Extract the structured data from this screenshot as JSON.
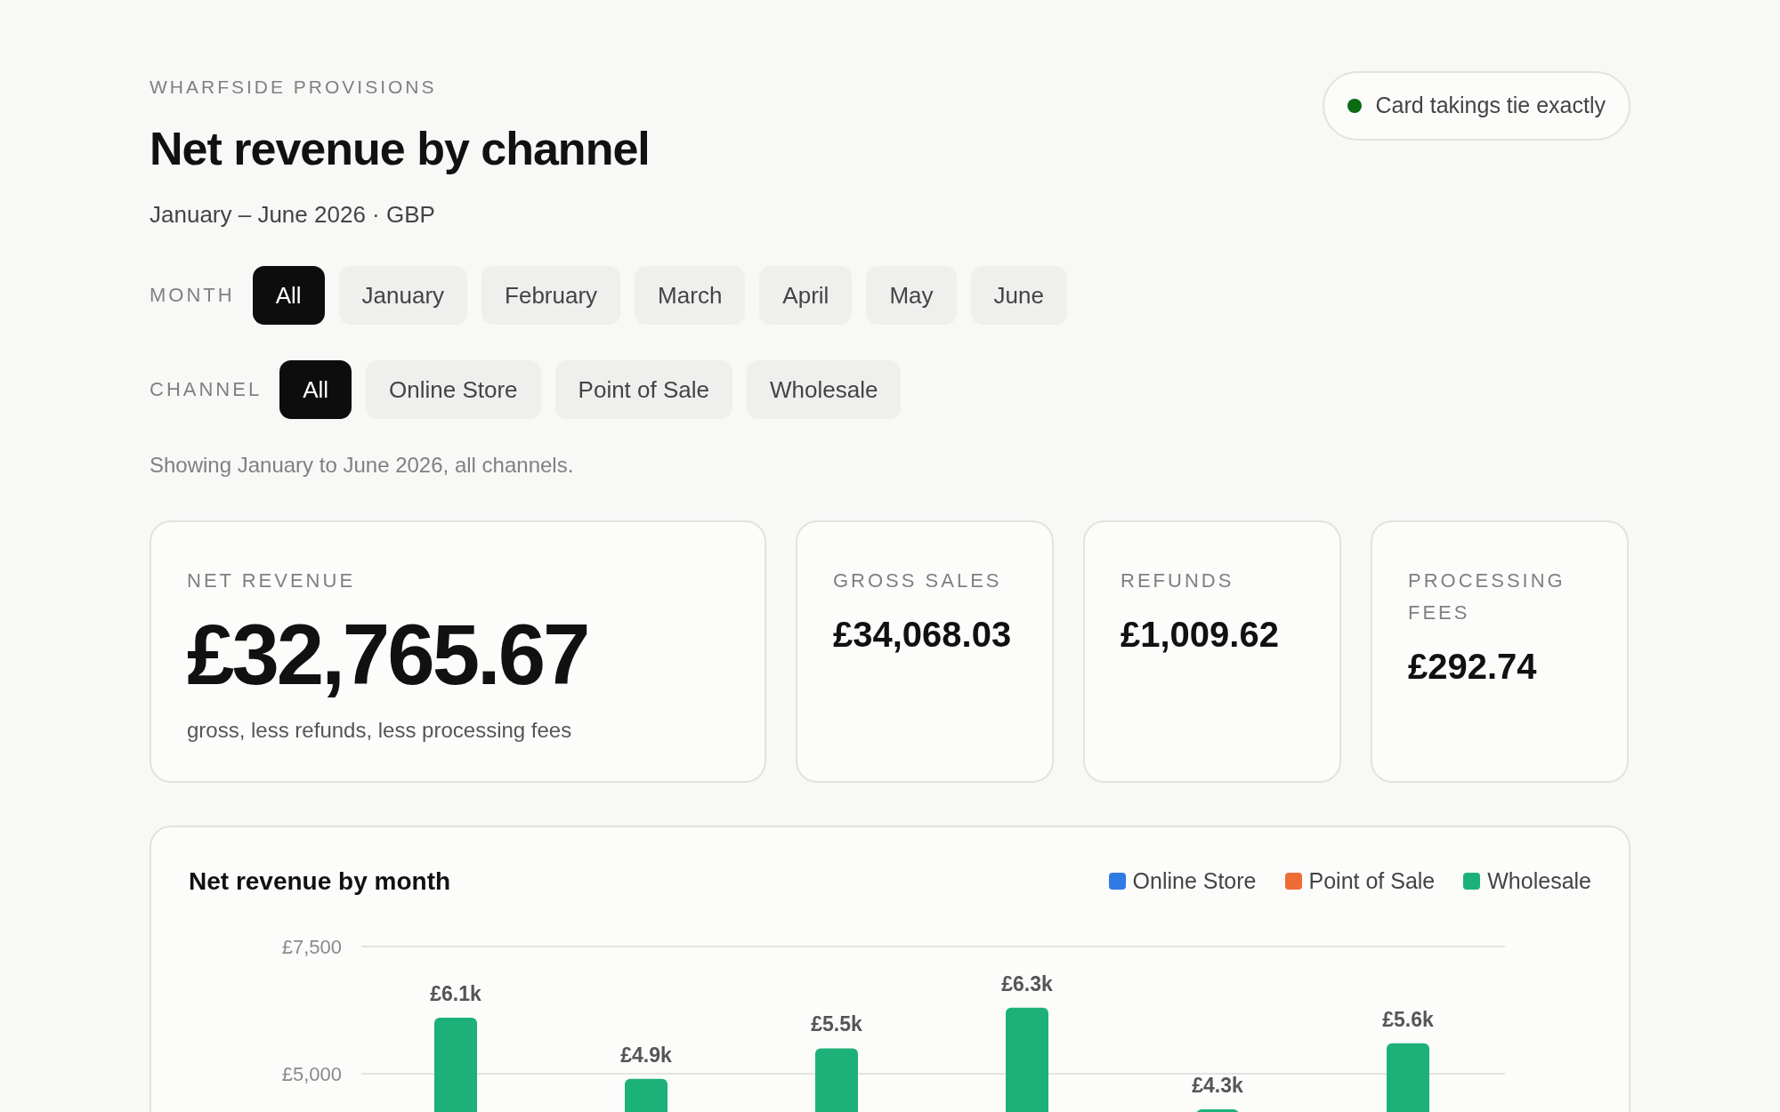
{
  "brand": "WHARFSIDE PROVISIONS",
  "title": "Net revenue by channel",
  "subtitle": "January – June 2026 · GBP",
  "status": {
    "label": "Card takings tie exactly",
    "color": "#0a6b12"
  },
  "filters": [
    {
      "label": "MONTH",
      "options": [
        {
          "label": "All",
          "selected": true
        },
        {
          "label": "January",
          "selected": false
        },
        {
          "label": "February",
          "selected": false
        },
        {
          "label": "March",
          "selected": false
        },
        {
          "label": "April",
          "selected": false
        },
        {
          "label": "May",
          "selected": false
        },
        {
          "label": "June",
          "selected": false
        }
      ]
    },
    {
      "label": "CHANNEL",
      "options": [
        {
          "label": "All",
          "selected": true
        },
        {
          "label": "Online Store",
          "selected": false
        },
        {
          "label": "Point of Sale",
          "selected": false
        },
        {
          "label": "Wholesale",
          "selected": false
        }
      ]
    }
  ],
  "note": "Showing January to June 2026, all channels.",
  "metrics": [
    {
      "kind": "primary",
      "label": "NET REVENUE",
      "value": "£32,765.67",
      "caption": "gross, less refunds, less processing fees"
    },
    {
      "kind": "standard",
      "label": "GROSS SALES",
      "value": "£34,068.03"
    },
    {
      "kind": "standard",
      "label": "REFUNDS",
      "value": "£1,009.62"
    },
    {
      "kind": "standard",
      "label": "PROCESSING FEES",
      "value": "£292.74"
    }
  ],
  "chart_panel": {
    "legend": [
      {
        "label": "Online Store",
        "color": "#2f7ae5"
      },
      {
        "label": "Point of Sale",
        "color": "#ef6c35"
      },
      {
        "label": "Wholesale",
        "color": "#1db17a"
      }
    ],
    "chart_data": {
      "type": "bar",
      "title": "Net revenue by month",
      "series": [
        {
          "color": "#1db17a",
          "values": [
            6100,
            4900,
            5500,
            6300,
            4300,
            5600
          ]
        }
      ],
      "ylim": [
        0,
        7500
      ],
      "yticks": [
        {
          "value": 5000,
          "label": "£5,000"
        },
        {
          "value": 7500,
          "label": "£7,500"
        }
      ],
      "value_labels": [
        "£6.1k",
        "£4.9k",
        "£5.5k",
        "£6.3k",
        "£4.3k",
        "£5.6k"
      ]
    }
  }
}
